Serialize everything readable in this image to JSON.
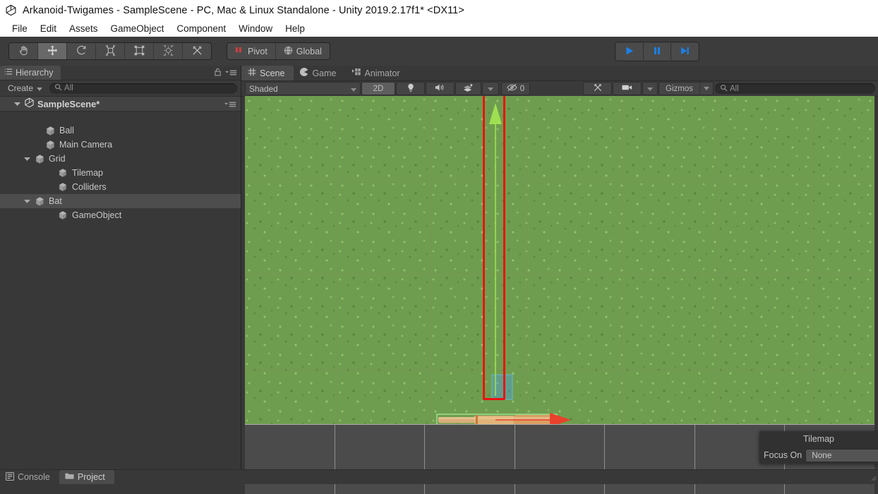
{
  "window": {
    "title": "Arkanoid-Twigames - SampleScene - PC, Mac & Linux Standalone - Unity 2019.2.17f1* <DX11>",
    "logo_icon": "unity-logo-icon"
  },
  "menubar": {
    "items": [
      {
        "label": "File"
      },
      {
        "label": "Edit"
      },
      {
        "label": "Assets"
      },
      {
        "label": "GameObject"
      },
      {
        "label": "Component"
      },
      {
        "label": "Window"
      },
      {
        "label": "Help"
      }
    ]
  },
  "toolbar": {
    "transform_tools": [
      {
        "name": "hand-tool",
        "icon": "hand-icon",
        "active": false
      },
      {
        "name": "move-tool",
        "icon": "move-arrows-icon",
        "active": true
      },
      {
        "name": "rotate-tool",
        "icon": "rotate-icon",
        "active": false
      },
      {
        "name": "scale-tool",
        "icon": "scale-icon",
        "active": false
      },
      {
        "name": "rect-tool",
        "icon": "rect-transform-icon",
        "active": false
      },
      {
        "name": "transform-tool",
        "icon": "move-rotate-scale-icon",
        "active": false
      },
      {
        "name": "custom-tool",
        "icon": "wrench-screwdriver-icon",
        "active": false
      }
    ],
    "pivot_label": "Pivot",
    "pivot_icon": "pivot-center-icon",
    "handle_space_label": "Global",
    "handle_space_icon": "globe-icon",
    "play_controls": [
      {
        "name": "play-button",
        "icon": "play-triangle-icon"
      },
      {
        "name": "pause-button",
        "icon": "pause-bars-icon"
      },
      {
        "name": "step-button",
        "icon": "step-forward-icon"
      }
    ]
  },
  "annotation": {
    "color": "#ee1111",
    "targets": [
      "handle-space-global-button",
      "scene-y-axis-gizmo"
    ]
  },
  "hierarchy": {
    "tab_label": "Hierarchy",
    "tab_icon": "hierarchy-icon",
    "lock_icon": "lock-icon",
    "menu_icon": "panel-menu-icon",
    "create_label": "Create",
    "search_placeholder": "All",
    "search_icon": "search-icon",
    "scene_name": "SampleScene*",
    "scene_icon": "unity-scene-icon",
    "items": [
      {
        "label": "Ball",
        "depth": 1,
        "expandable": false,
        "selected": false
      },
      {
        "label": "Main Camera",
        "depth": 1,
        "expandable": false,
        "selected": false
      },
      {
        "label": "Grid",
        "depth": 1,
        "expandable": true,
        "expanded": true,
        "selected": false
      },
      {
        "label": "Tilemap",
        "depth": 2,
        "expandable": false,
        "selected": false
      },
      {
        "label": "Colliders",
        "depth": 2,
        "expandable": false,
        "selected": false
      },
      {
        "label": "Bat",
        "depth": 1,
        "expandable": true,
        "expanded": true,
        "selected": true
      },
      {
        "label": "GameObject",
        "depth": 2,
        "expandable": false,
        "selected": false
      }
    ]
  },
  "sceneview": {
    "tabs": [
      {
        "label": "Scene",
        "icon": "scene-grid-icon",
        "active": true
      },
      {
        "label": "Game",
        "icon": "game-pacman-icon",
        "active": false
      },
      {
        "label": "Animator",
        "icon": "animator-icon",
        "active": false
      }
    ],
    "draw_mode": "Shaded",
    "draw_mode_arrow": "chevron-down-icon",
    "toggle_2d": "2D",
    "lighting_icon": "lightbulb-icon",
    "audio_icon": "speaker-icon",
    "effects_icon": "effects-layers-icon",
    "effects_arrow": "chevron-down-icon",
    "hidden_icon": "eye-slash-icon",
    "hidden_count": "0",
    "tools_icon": "wrench-screwdriver-icon",
    "camera_icon": "camera-icon",
    "camera_arrow": "chevron-down-icon",
    "gizmos_label": "Gizmos",
    "gizmos_arrow": "chevron-down-icon",
    "search_placeholder": "All",
    "search_icon": "search-icon",
    "gizmo": {
      "x_axis_color": "#e8412c",
      "y_axis_color": "#9ee052",
      "plane_handle_color": "#4ca0d8"
    },
    "grass_color": "#6f9d4f"
  },
  "tilemap_overlay": {
    "title": "Tilemap",
    "focus_label": "Focus On",
    "focus_value": "None"
  },
  "bottom_tabs": [
    {
      "label": "Console",
      "icon": "console-icon",
      "active": false
    },
    {
      "label": "Project",
      "icon": "folder-icon",
      "active": true
    }
  ]
}
